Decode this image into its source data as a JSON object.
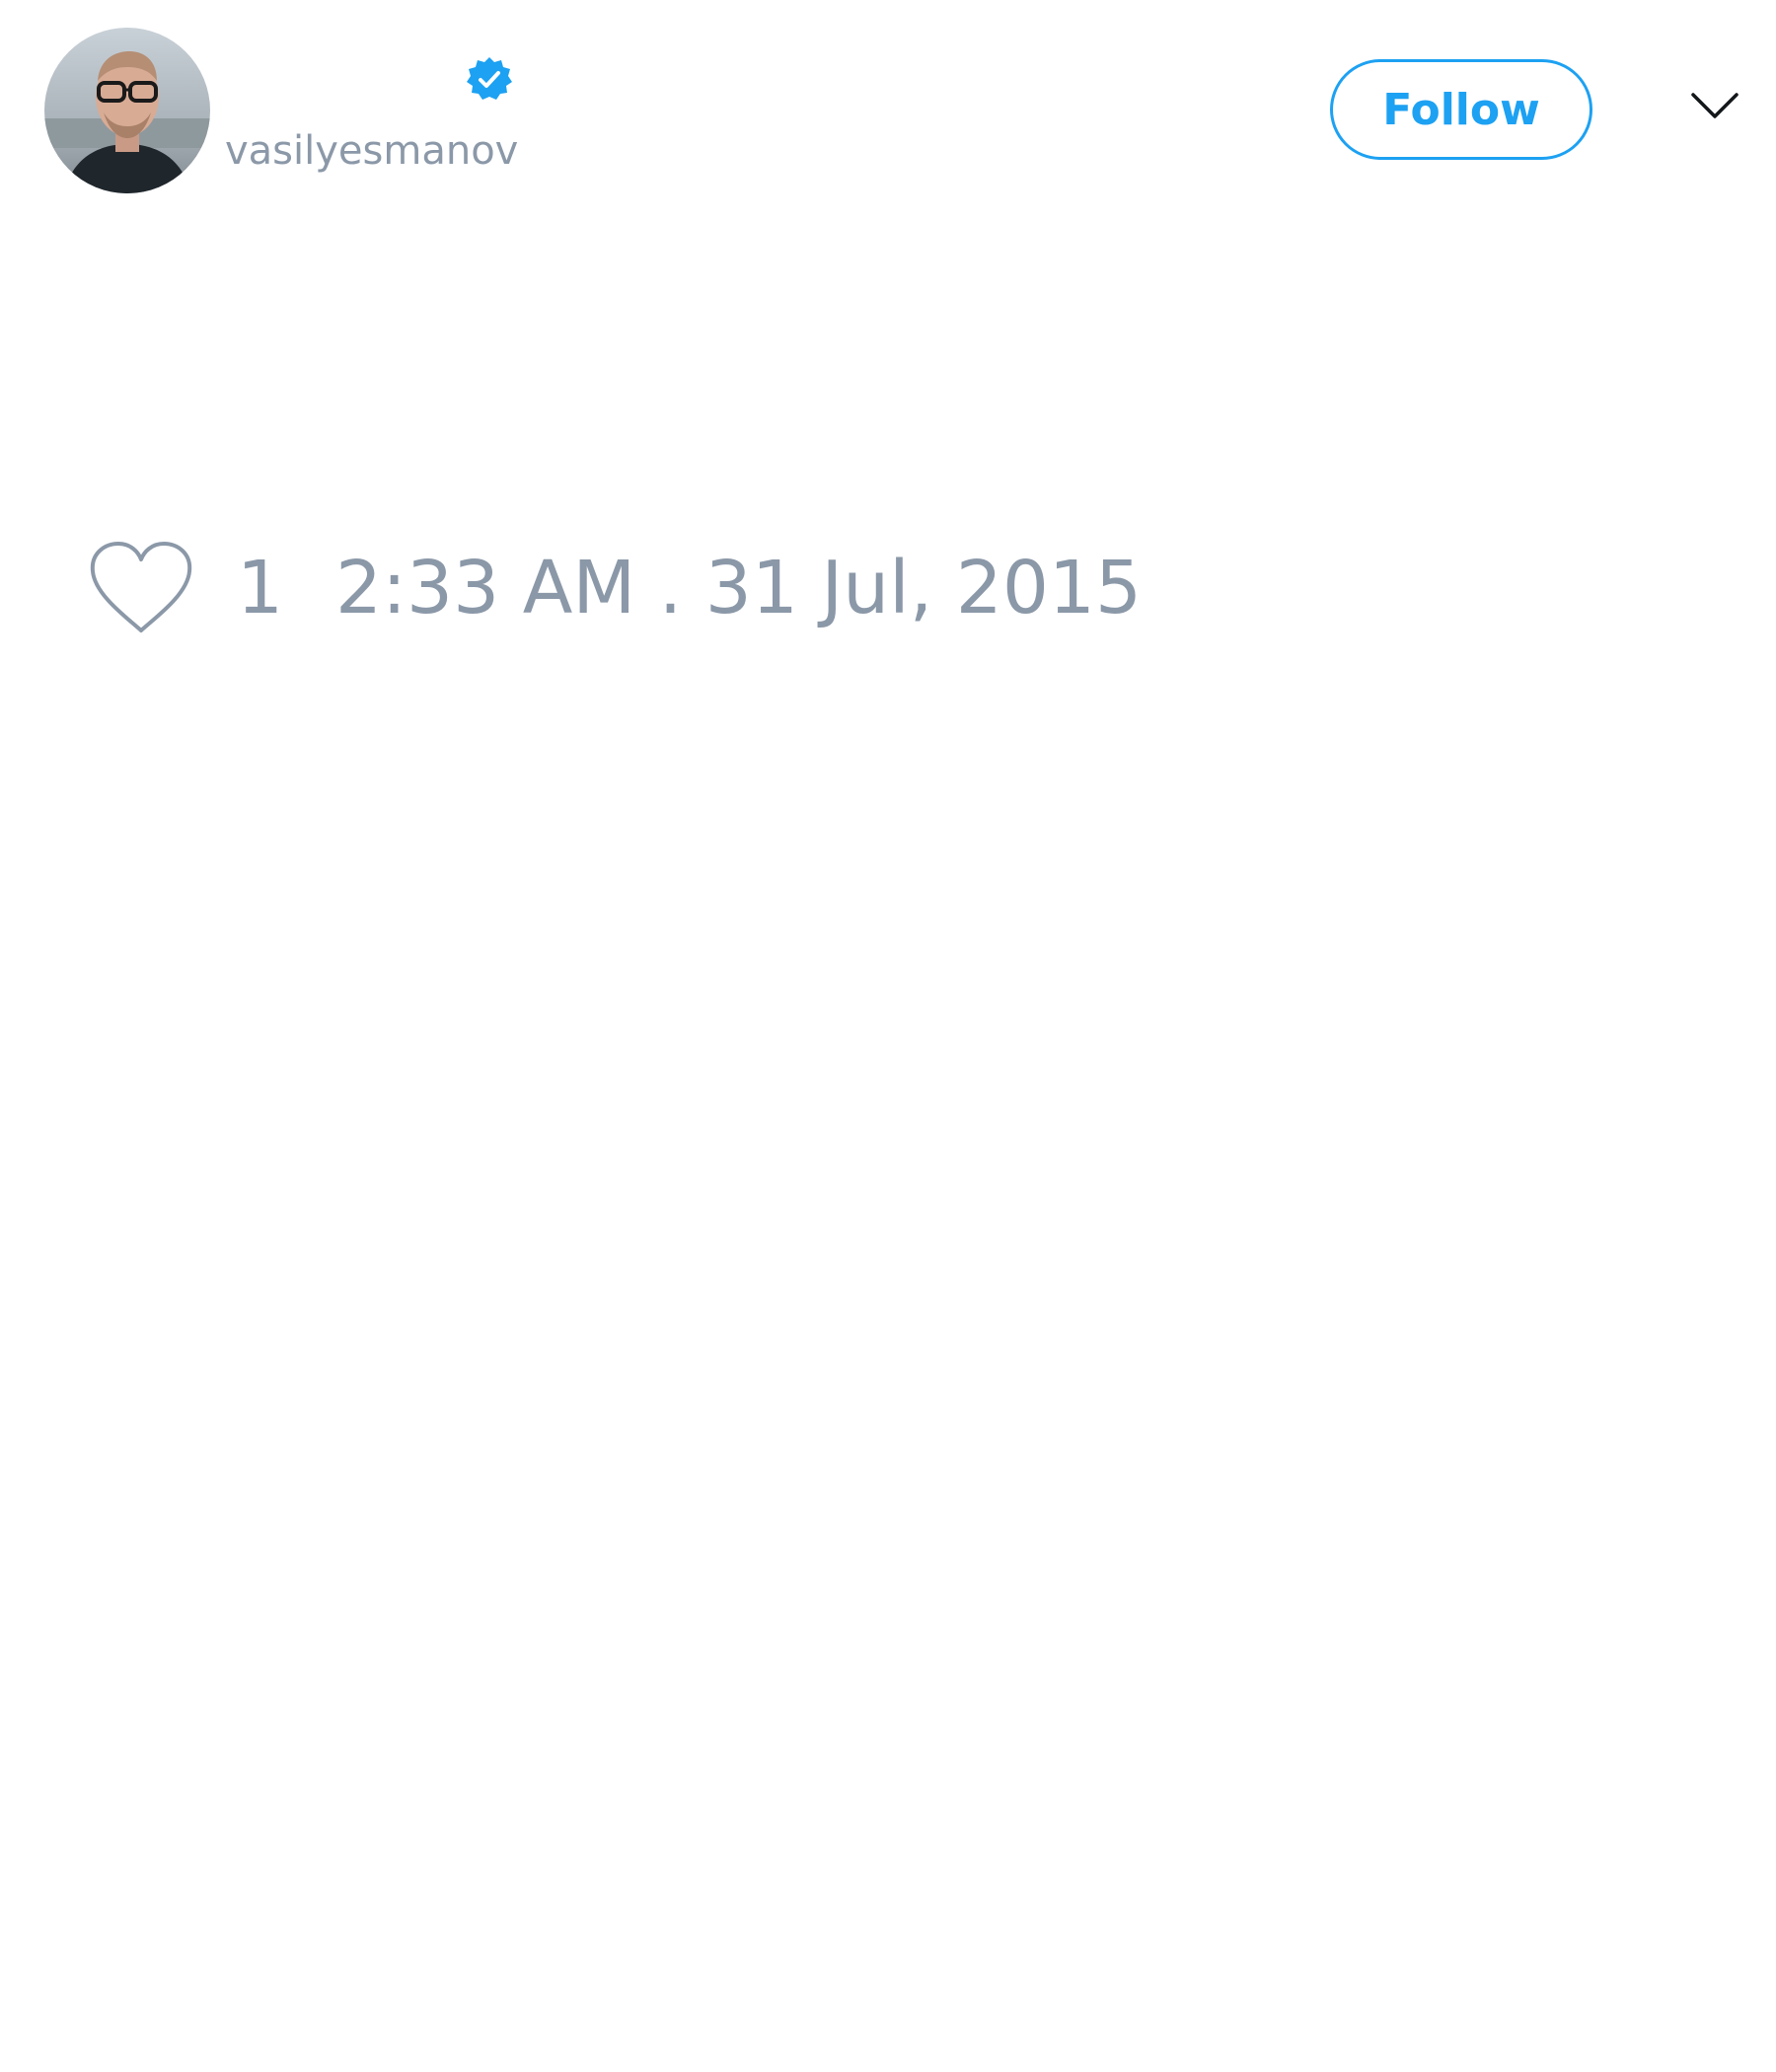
{
  "tweet": {
    "author": {
      "display_name": "",
      "handle": "vasilyesmanov",
      "verified": true
    },
    "follow_label": "Follow",
    "like_count": "1",
    "timestamp": "2:33 AM . 31 Jul, 2015"
  },
  "colors": {
    "accent": "#1da1f2",
    "muted_text": "#8b98a8",
    "background": "#ffffff"
  },
  "icons": {
    "verified": "verified-badge-icon",
    "like": "heart-outline-icon",
    "menu": "chevron-down-icon"
  }
}
